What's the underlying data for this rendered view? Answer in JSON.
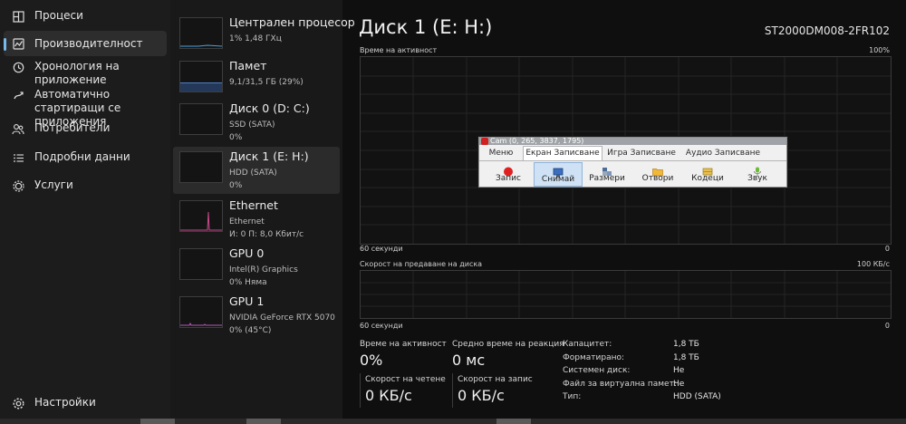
{
  "nav": {
    "items": [
      {
        "label": "Процеси",
        "icon": "processes-icon"
      },
      {
        "label": "Производителност",
        "icon": "performance-icon"
      },
      {
        "label": "Хронология на приложение",
        "icon": "history-icon"
      },
      {
        "label": "Автоматично стартиращи се приложения",
        "icon": "startup-icon"
      },
      {
        "label": "Потребители",
        "icon": "users-icon"
      },
      {
        "label": "Подробни данни",
        "icon": "details-icon"
      },
      {
        "label": "Услуги",
        "icon": "services-icon"
      }
    ],
    "settings": {
      "label": "Настройки",
      "icon": "settings-icon"
    }
  },
  "devices": [
    {
      "name": "Централен процесор",
      "line1": "1% 1,48 ГХц",
      "line2": ""
    },
    {
      "name": "Памет",
      "line1": "9,1/31,5 ГБ (29%)",
      "line2": ""
    },
    {
      "name": "Диск 0 (D: C:)",
      "line1": "SSD (SATA)",
      "line2": "0%"
    },
    {
      "name": "Диск 1 (E: H:)",
      "line1": "HDD (SATA)",
      "line2": "0%"
    },
    {
      "name": "Ethernet",
      "line1": "Ethernet",
      "line2": "И: 0 П: 8,0 Кбит/с"
    },
    {
      "name": "GPU 0",
      "line1": "Intel(R) Graphics",
      "line2": "0% Няма"
    },
    {
      "name": "GPU 1",
      "line1": "NVIDIA GeForce RTX 5070",
      "line2": "0% (45°C)"
    }
  ],
  "main": {
    "title": "Диск 1 (E: H:)",
    "model": "ST2000DM008-2FR102",
    "graph1": {
      "label": "Време на активност",
      "max": "100%",
      "time": "60 секунди",
      "min": "0"
    },
    "graph2": {
      "label": "Скорост на предаване на диска",
      "max": "100 КБ/с",
      "time": "60 секунди",
      "min": "0"
    },
    "stats": {
      "active_label": "Време на активност",
      "active_value": "0%",
      "response_label": "Средно време на реакция",
      "response_value": "0 мс",
      "read_label": "Скорост на четене",
      "read_value": "0 КБ/с",
      "write_label": "Скорост на запис",
      "write_value": "0 КБ/с"
    },
    "props": [
      {
        "k": "Капацитет:",
        "v": "1,8 ТБ"
      },
      {
        "k": "Форматирано:",
        "v": "1,8 ТБ"
      },
      {
        "k": "Системен диск:",
        "v": "Не"
      },
      {
        "k": "Файл за виртуална памет:",
        "v": "Не"
      },
      {
        "k": "Тип:",
        "v": "HDD (SATA)"
      }
    ]
  },
  "cam": {
    "title": "Cam (0, 265, 3837, 1795)",
    "tabs": [
      "Меню",
      "Екран Записване",
      "Игра Записване",
      "Аудио Записване"
    ],
    "tools": [
      {
        "label": "Запис",
        "icon": "record-icon"
      },
      {
        "label": "Снимай",
        "icon": "screenshot-icon"
      },
      {
        "label": "Размери",
        "icon": "dimensions-icon"
      },
      {
        "label": "Отвори",
        "icon": "open-folder-icon"
      },
      {
        "label": "Кодеци",
        "icon": "codecs-icon"
      },
      {
        "label": "Звук",
        "icon": "microphone-icon"
      }
    ]
  }
}
